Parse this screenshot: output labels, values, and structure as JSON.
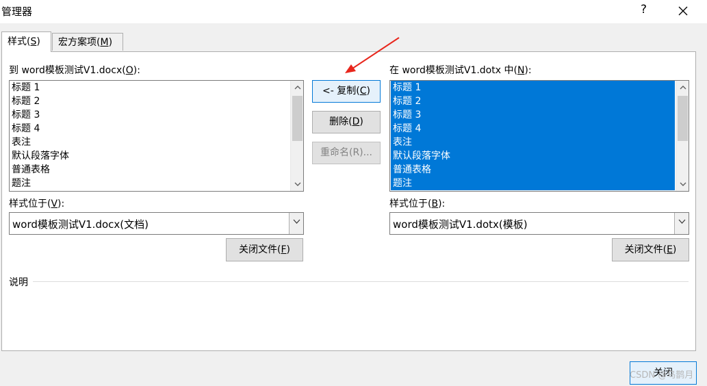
{
  "window": {
    "title": "管理器",
    "help_label": "?"
  },
  "tabs": [
    {
      "text": "样式(",
      "key": "S",
      "tail": ")"
    },
    {
      "text": "宏方案项(",
      "key": "M",
      "tail": ")"
    }
  ],
  "left": {
    "list_label": {
      "text": "到 word模板测试V1.docx(",
      "key": "O",
      "tail": "):"
    },
    "items": [
      "标题 1",
      "标题 2",
      "标题 3",
      "标题 4",
      "表注",
      "默认段落字体",
      "普通表格",
      "题注"
    ],
    "location_label": {
      "text": "样式位于(",
      "key": "V",
      "tail": "):"
    },
    "location_value": "word模板测试V1.docx(文档)",
    "close_file": {
      "text": "关闭文件(",
      "key": "F",
      "tail": ")"
    }
  },
  "right": {
    "list_label": {
      "text": "在 word模板测试V1.dotx 中(",
      "key": "N",
      "tail": "):"
    },
    "items": [
      "标题 1",
      "标题 2",
      "标题 3",
      "标题 4",
      "表注",
      "默认段落字体",
      "普通表格",
      "题注"
    ],
    "location_label": {
      "text": "样式位于(",
      "key": "B",
      "tail": "):"
    },
    "location_value": "word模板测试V1.dotx(模板)",
    "close_file": {
      "text": "关闭文件(",
      "key": "E",
      "tail": ")"
    }
  },
  "actions": {
    "copy": {
      "text": "<- 复制(",
      "key": "C",
      "tail": ")"
    },
    "delete": {
      "text": "删除(",
      "key": "D",
      "tail": ")"
    },
    "rename": "重命名(R)..."
  },
  "description_label": "说明",
  "close_button": "关闭",
  "watermark": "CSDN @乌鹊月",
  "colors": {
    "selection": "#0078d7",
    "arrow": "#e8261c"
  }
}
